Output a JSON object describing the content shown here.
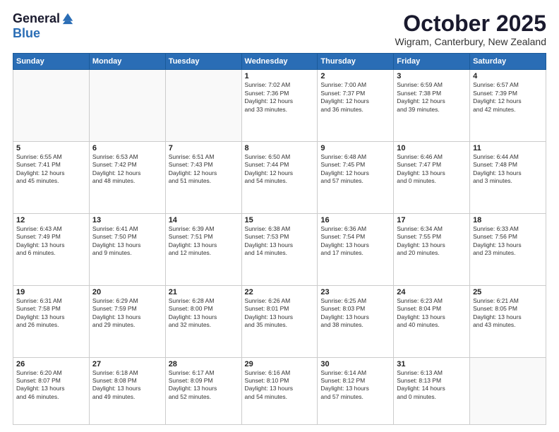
{
  "logo": {
    "general": "General",
    "blue": "Blue"
  },
  "header": {
    "month": "October 2025",
    "location": "Wigram, Canterbury, New Zealand"
  },
  "weekdays": [
    "Sunday",
    "Monday",
    "Tuesday",
    "Wednesday",
    "Thursday",
    "Friday",
    "Saturday"
  ],
  "weeks": [
    [
      {
        "day": "",
        "info": ""
      },
      {
        "day": "",
        "info": ""
      },
      {
        "day": "",
        "info": ""
      },
      {
        "day": "1",
        "info": "Sunrise: 7:02 AM\nSunset: 7:36 PM\nDaylight: 12 hours\nand 33 minutes."
      },
      {
        "day": "2",
        "info": "Sunrise: 7:00 AM\nSunset: 7:37 PM\nDaylight: 12 hours\nand 36 minutes."
      },
      {
        "day": "3",
        "info": "Sunrise: 6:59 AM\nSunset: 7:38 PM\nDaylight: 12 hours\nand 39 minutes."
      },
      {
        "day": "4",
        "info": "Sunrise: 6:57 AM\nSunset: 7:39 PM\nDaylight: 12 hours\nand 42 minutes."
      }
    ],
    [
      {
        "day": "5",
        "info": "Sunrise: 6:55 AM\nSunset: 7:41 PM\nDaylight: 12 hours\nand 45 minutes."
      },
      {
        "day": "6",
        "info": "Sunrise: 6:53 AM\nSunset: 7:42 PM\nDaylight: 12 hours\nand 48 minutes."
      },
      {
        "day": "7",
        "info": "Sunrise: 6:51 AM\nSunset: 7:43 PM\nDaylight: 12 hours\nand 51 minutes."
      },
      {
        "day": "8",
        "info": "Sunrise: 6:50 AM\nSunset: 7:44 PM\nDaylight: 12 hours\nand 54 minutes."
      },
      {
        "day": "9",
        "info": "Sunrise: 6:48 AM\nSunset: 7:45 PM\nDaylight: 12 hours\nand 57 minutes."
      },
      {
        "day": "10",
        "info": "Sunrise: 6:46 AM\nSunset: 7:47 PM\nDaylight: 13 hours\nand 0 minutes."
      },
      {
        "day": "11",
        "info": "Sunrise: 6:44 AM\nSunset: 7:48 PM\nDaylight: 13 hours\nand 3 minutes."
      }
    ],
    [
      {
        "day": "12",
        "info": "Sunrise: 6:43 AM\nSunset: 7:49 PM\nDaylight: 13 hours\nand 6 minutes."
      },
      {
        "day": "13",
        "info": "Sunrise: 6:41 AM\nSunset: 7:50 PM\nDaylight: 13 hours\nand 9 minutes."
      },
      {
        "day": "14",
        "info": "Sunrise: 6:39 AM\nSunset: 7:51 PM\nDaylight: 13 hours\nand 12 minutes."
      },
      {
        "day": "15",
        "info": "Sunrise: 6:38 AM\nSunset: 7:53 PM\nDaylight: 13 hours\nand 14 minutes."
      },
      {
        "day": "16",
        "info": "Sunrise: 6:36 AM\nSunset: 7:54 PM\nDaylight: 13 hours\nand 17 minutes."
      },
      {
        "day": "17",
        "info": "Sunrise: 6:34 AM\nSunset: 7:55 PM\nDaylight: 13 hours\nand 20 minutes."
      },
      {
        "day": "18",
        "info": "Sunrise: 6:33 AM\nSunset: 7:56 PM\nDaylight: 13 hours\nand 23 minutes."
      }
    ],
    [
      {
        "day": "19",
        "info": "Sunrise: 6:31 AM\nSunset: 7:58 PM\nDaylight: 13 hours\nand 26 minutes."
      },
      {
        "day": "20",
        "info": "Sunrise: 6:29 AM\nSunset: 7:59 PM\nDaylight: 13 hours\nand 29 minutes."
      },
      {
        "day": "21",
        "info": "Sunrise: 6:28 AM\nSunset: 8:00 PM\nDaylight: 13 hours\nand 32 minutes."
      },
      {
        "day": "22",
        "info": "Sunrise: 6:26 AM\nSunset: 8:01 PM\nDaylight: 13 hours\nand 35 minutes."
      },
      {
        "day": "23",
        "info": "Sunrise: 6:25 AM\nSunset: 8:03 PM\nDaylight: 13 hours\nand 38 minutes."
      },
      {
        "day": "24",
        "info": "Sunrise: 6:23 AM\nSunset: 8:04 PM\nDaylight: 13 hours\nand 40 minutes."
      },
      {
        "day": "25",
        "info": "Sunrise: 6:21 AM\nSunset: 8:05 PM\nDaylight: 13 hours\nand 43 minutes."
      }
    ],
    [
      {
        "day": "26",
        "info": "Sunrise: 6:20 AM\nSunset: 8:07 PM\nDaylight: 13 hours\nand 46 minutes."
      },
      {
        "day": "27",
        "info": "Sunrise: 6:18 AM\nSunset: 8:08 PM\nDaylight: 13 hours\nand 49 minutes."
      },
      {
        "day": "28",
        "info": "Sunrise: 6:17 AM\nSunset: 8:09 PM\nDaylight: 13 hours\nand 52 minutes."
      },
      {
        "day": "29",
        "info": "Sunrise: 6:16 AM\nSunset: 8:10 PM\nDaylight: 13 hours\nand 54 minutes."
      },
      {
        "day": "30",
        "info": "Sunrise: 6:14 AM\nSunset: 8:12 PM\nDaylight: 13 hours\nand 57 minutes."
      },
      {
        "day": "31",
        "info": "Sunrise: 6:13 AM\nSunset: 8:13 PM\nDaylight: 14 hours\nand 0 minutes."
      },
      {
        "day": "",
        "info": ""
      }
    ]
  ]
}
